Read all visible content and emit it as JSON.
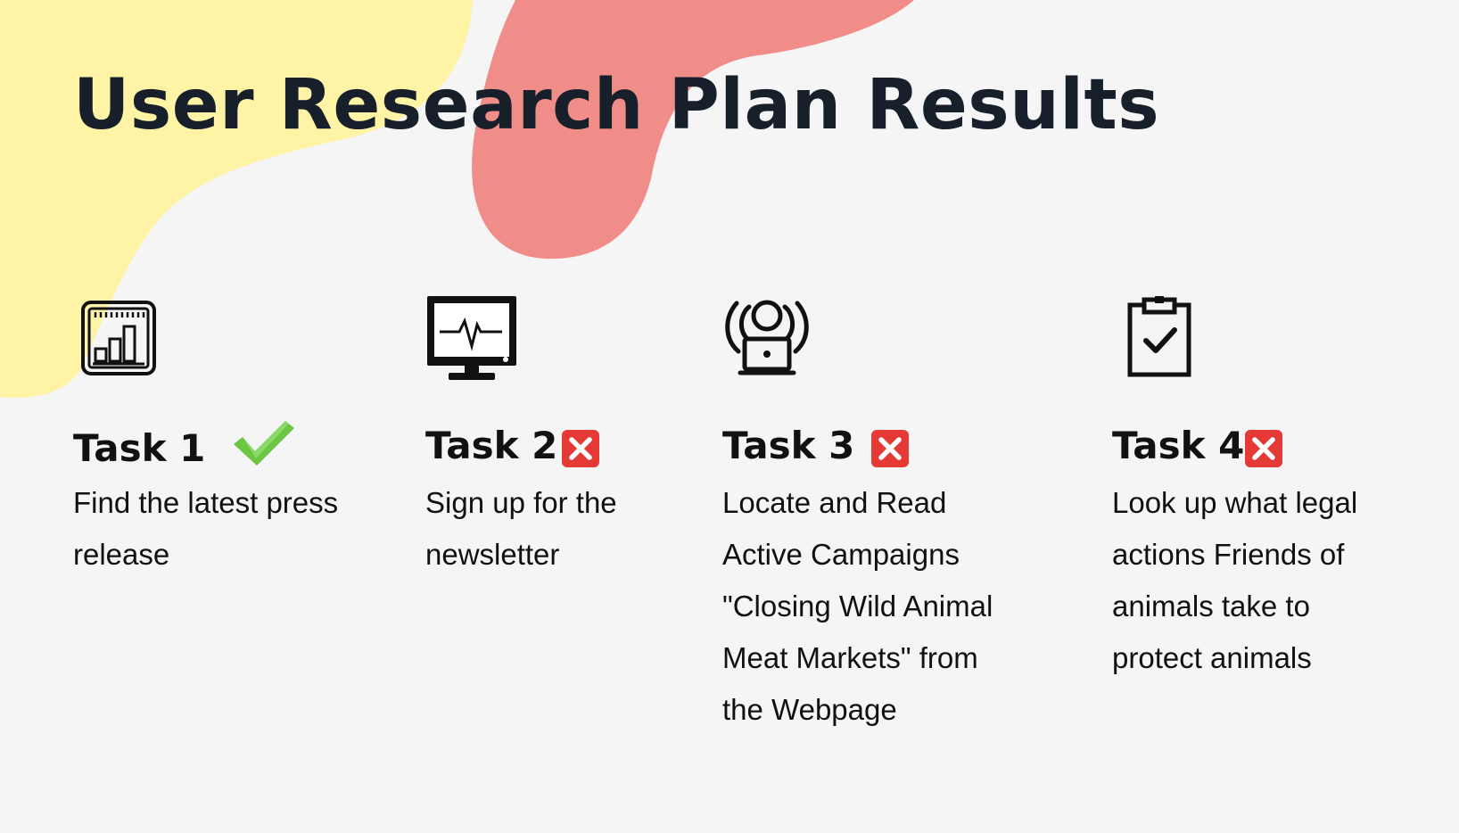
{
  "slide": {
    "title": "User Research Plan Results"
  },
  "tasks": [
    {
      "label": "Task 1",
      "description": "Find the latest press release",
      "status": "success",
      "status_icon": "check-mark-icon",
      "icon": "analytics-chart-icon"
    },
    {
      "label": "Task 2",
      "description": "Sign up for the newsletter",
      "status": "failed",
      "status_icon": "cross-mark-icon",
      "icon": "monitor-heartbeat-icon"
    },
    {
      "label": "Task 3",
      "description": "Locate and Read Active Campaigns \"Closing Wild Animal Meat Markets\" from the Webpage",
      "status": "failed",
      "status_icon": "cross-mark-icon",
      "icon": "person-laptop-icon"
    },
    {
      "label": "Task 4",
      "description": "Look up what legal actions Friends of animals take to protect animals",
      "status": "failed",
      "status_icon": "cross-mark-icon",
      "icon": "clipboard-check-icon"
    }
  ],
  "colors": {
    "background": "#f5f5f5",
    "yellow_blob": "#fff3a6",
    "coral_blob": "#f08d88",
    "title_text": "#17202a",
    "success_green": "#6cc644",
    "fail_red": "#e53935"
  }
}
